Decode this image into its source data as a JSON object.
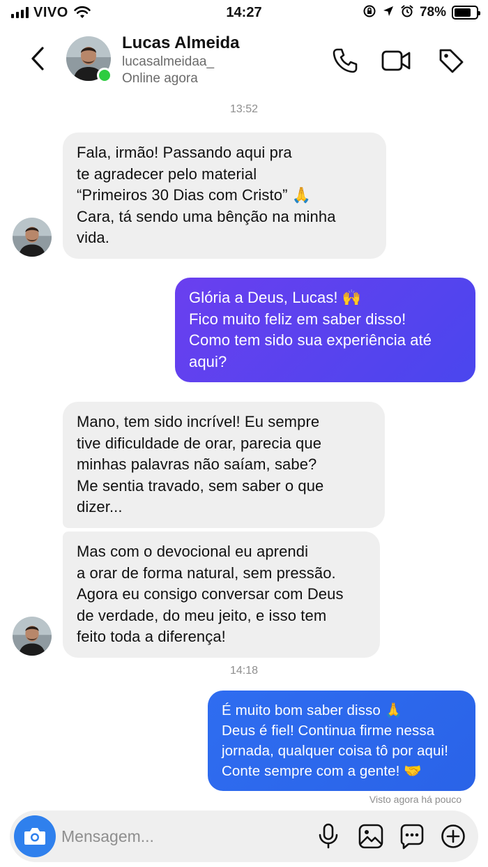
{
  "status_bar": {
    "carrier": "VIVO",
    "time": "14:27",
    "battery": "78%",
    "battery_level": 0.78,
    "icons": [
      "signal-icon",
      "wifi-icon",
      "screen-lock-icon",
      "location-icon",
      "alarm-icon",
      "battery-icon"
    ]
  },
  "header": {
    "name": "Lucas Almeida",
    "handle": "lucasalmeidaa_",
    "status": "Online agora",
    "online_color": "#2ecc40",
    "icons": [
      "back-icon",
      "phone-icon",
      "video-icon",
      "tag-icon"
    ]
  },
  "chat": {
    "timestamps": [
      "13:52",
      "14:18"
    ],
    "messages": [
      {
        "from": "them",
        "text": "Fala, irmão! Passando aqui pra\nte agradecer pelo material\n“Primeiros 30 Dias com Cristo” 🙏\nCara, tá sendo uma bênção na minha\nvida."
      },
      {
        "from": "me",
        "text": "Glória a Deus, Lucas! 🙌\nFico muito feliz em saber disso!\nComo tem sido sua experiência até\naqui?"
      },
      {
        "from": "them",
        "text": "Mano, tem sido incrível! Eu sempre\ntive dificuldade de orar, parecia que\nminhas palavras não saíam, sabe?\nMe sentia travado, sem saber o que\ndizer..."
      },
      {
        "from": "them",
        "text": "Mas com o devocional eu aprendi\na orar de forma natural, sem pressão.\nAgora eu consigo conversar com Deus\nde verdade, do meu jeito, e isso tem\nfeito toda a diferença!"
      },
      {
        "from": "me",
        "text": "É muito bom saber disso 🙏\nDeus é fiel! Continua firme nessa\njornada, qualquer coisa tô por aqui!\nConte sempre com a gente! 🤝"
      }
    ],
    "seen": "Visto agora há pouco",
    "colors": {
      "incoming_bg": "#efefef",
      "outgoing_purple": "#5b3ff0",
      "outgoing_blue": "#2f6df0"
    }
  },
  "composer": {
    "placeholder": "Mensagem...",
    "icons": [
      "camera-icon",
      "microphone-icon",
      "gallery-icon",
      "sticker-icon",
      "plus-icon"
    ]
  }
}
